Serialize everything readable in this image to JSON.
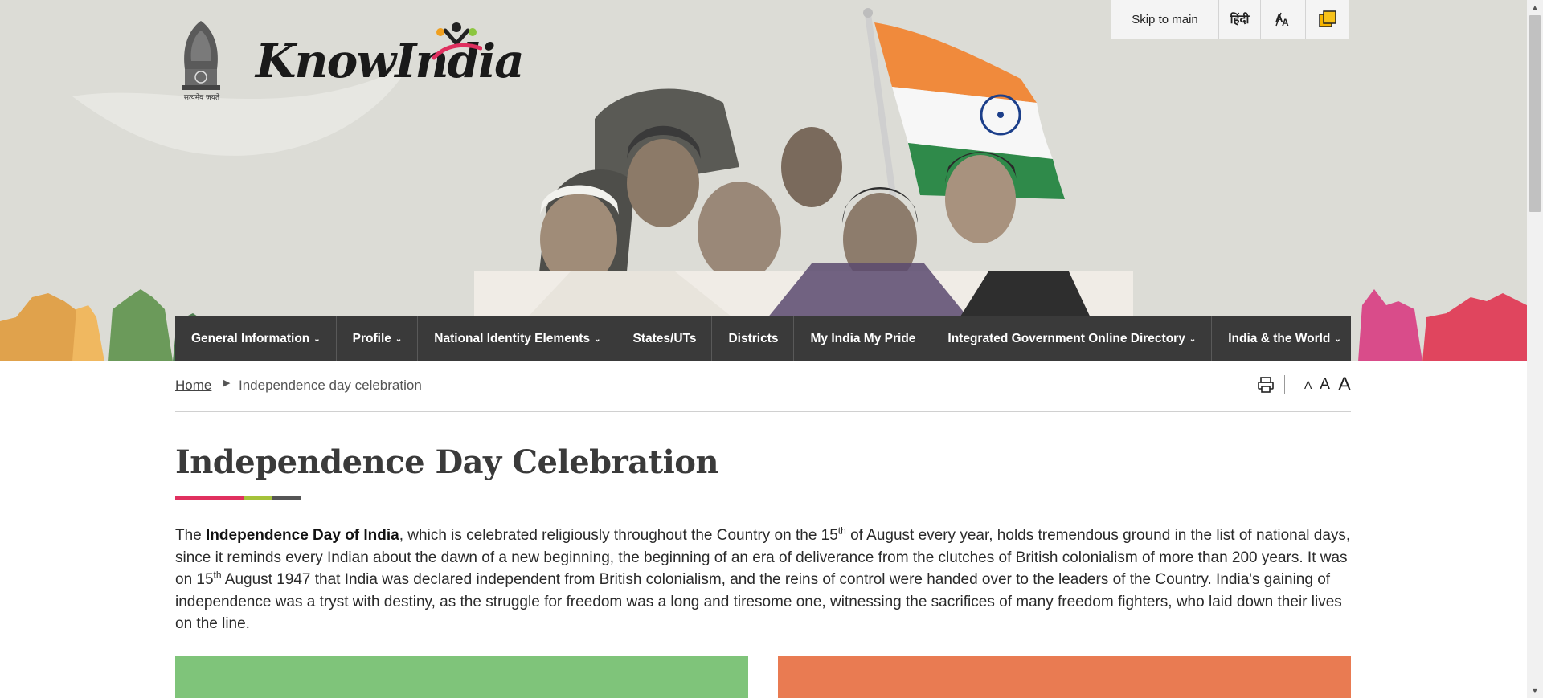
{
  "header": {
    "emblem_motto": "सत्यमेव जयते",
    "logo_text": "KnowIndia"
  },
  "utility": {
    "skip_label": "Skip to main",
    "hindi_label": "हिंदी",
    "font_icon": "font-size-icon",
    "contrast_icon": "contrast-icon"
  },
  "nav": {
    "items": [
      {
        "label": "General Information",
        "has_dropdown": true
      },
      {
        "label": "Profile",
        "has_dropdown": true
      },
      {
        "label": "National Identity Elements",
        "has_dropdown": true
      },
      {
        "label": "States/UTs",
        "has_dropdown": false
      },
      {
        "label": "Districts",
        "has_dropdown": false
      },
      {
        "label": "My India My Pride",
        "has_dropdown": false
      },
      {
        "label": "Integrated Government Online Directory",
        "has_dropdown": true
      },
      {
        "label": "India & the World",
        "has_dropdown": true
      }
    ]
  },
  "breadcrumb": {
    "home": "Home",
    "current": "Independence day celebration"
  },
  "tools": {
    "print_icon": "print-icon",
    "font_small": "A",
    "font_medium": "A",
    "font_large": "A"
  },
  "page": {
    "title": "Independence Day Celebration",
    "intro": {
      "p1": "The ",
      "bold": "Independence Day of India",
      "p2": ", which is celebrated religiously throughout the Country on the 15",
      "sup1": "th",
      "p3": " of August every year, holds tremendous ground in the list of national days, since it reminds every Indian about the dawn of a new beginning, the beginning of an era of deliverance from the clutches of British colonialism of more than 200 years. It was on 15",
      "sup2": "th",
      "p4": " August 1947 that India was declared independent from British colonialism, and the reins of control were handed over to the leaders of the Country. India's gaining of independence was a tryst with destiny, as the struggle for freedom was a long and tiresome one, witnessing the sacrifices of many freedom fighters, who laid down their lives on the line."
    }
  },
  "colors": {
    "nav_bg": "#3a3a3a",
    "banner_bg": "#dcdcd6",
    "underline_pink": "#e0305f",
    "underline_green": "#a5c23a",
    "underline_gray": "#555555",
    "card_green": "#7fc47a",
    "card_orange": "#e97b52"
  }
}
